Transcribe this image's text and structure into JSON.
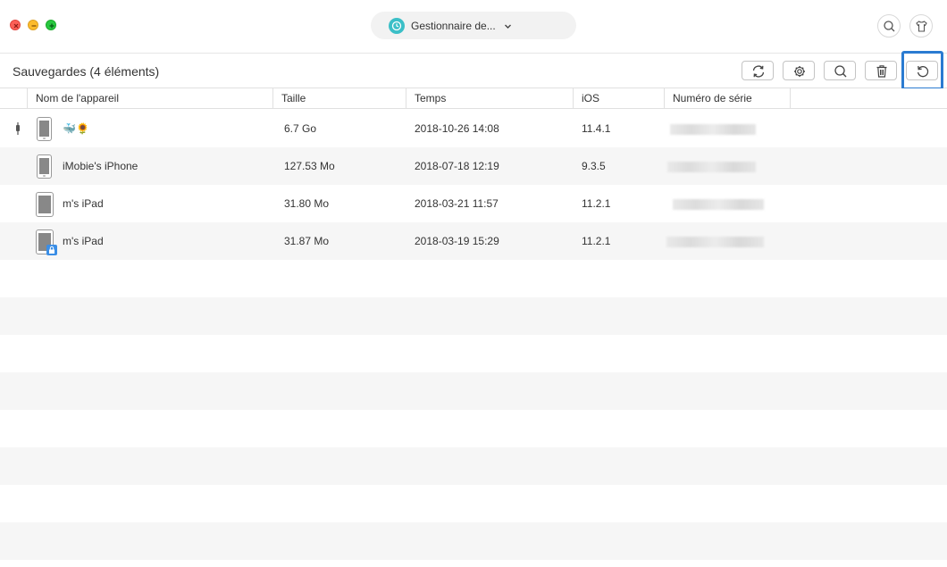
{
  "window": {
    "device_selector_label": "Gestionnaire de...",
    "icons": [
      "close-icon",
      "minimize-icon",
      "maximize-icon",
      "backup-manager-icon",
      "chevron-down-icon",
      "search-icon",
      "tshirt-icon"
    ]
  },
  "header": {
    "title": "Sauvegardes (4 éléments)",
    "tools": [
      "refresh-icon",
      "settings-icon",
      "search-icon",
      "trash-icon",
      "restore-icon"
    ]
  },
  "table": {
    "columns": [
      "Nom de l'appareil",
      "Taille",
      "Temps",
      "iOS",
      "Numéro de série"
    ],
    "rows": [
      {
        "name": "🐳🌻",
        "size": "6.7 Go",
        "time": "2018-10-26 14:08",
        "ios": "11.4.1",
        "device": "iphone",
        "usb": true,
        "locked": false
      },
      {
        "name": "iMobie's iPhone",
        "size": "127.53 Mo",
        "time": "2018-07-18 12:19",
        "ios": "9.3.5",
        "device": "iphone",
        "usb": false,
        "locked": false
      },
      {
        "name": "m's iPad",
        "size": "31.80 Mo",
        "time": "2018-03-21 11:57",
        "ios": "11.2.1",
        "device": "ipad",
        "usb": false,
        "locked": false
      },
      {
        "name": "m's iPad",
        "size": "31.87 Mo",
        "time": "2018-03-19 15:29",
        "ios": "11.2.1",
        "device": "ipad",
        "usb": false,
        "locked": true
      }
    ]
  },
  "colors": {
    "accent": "#3bbfc7",
    "highlight": "#2a7bd1",
    "row_alt": "#f6f6f6"
  }
}
